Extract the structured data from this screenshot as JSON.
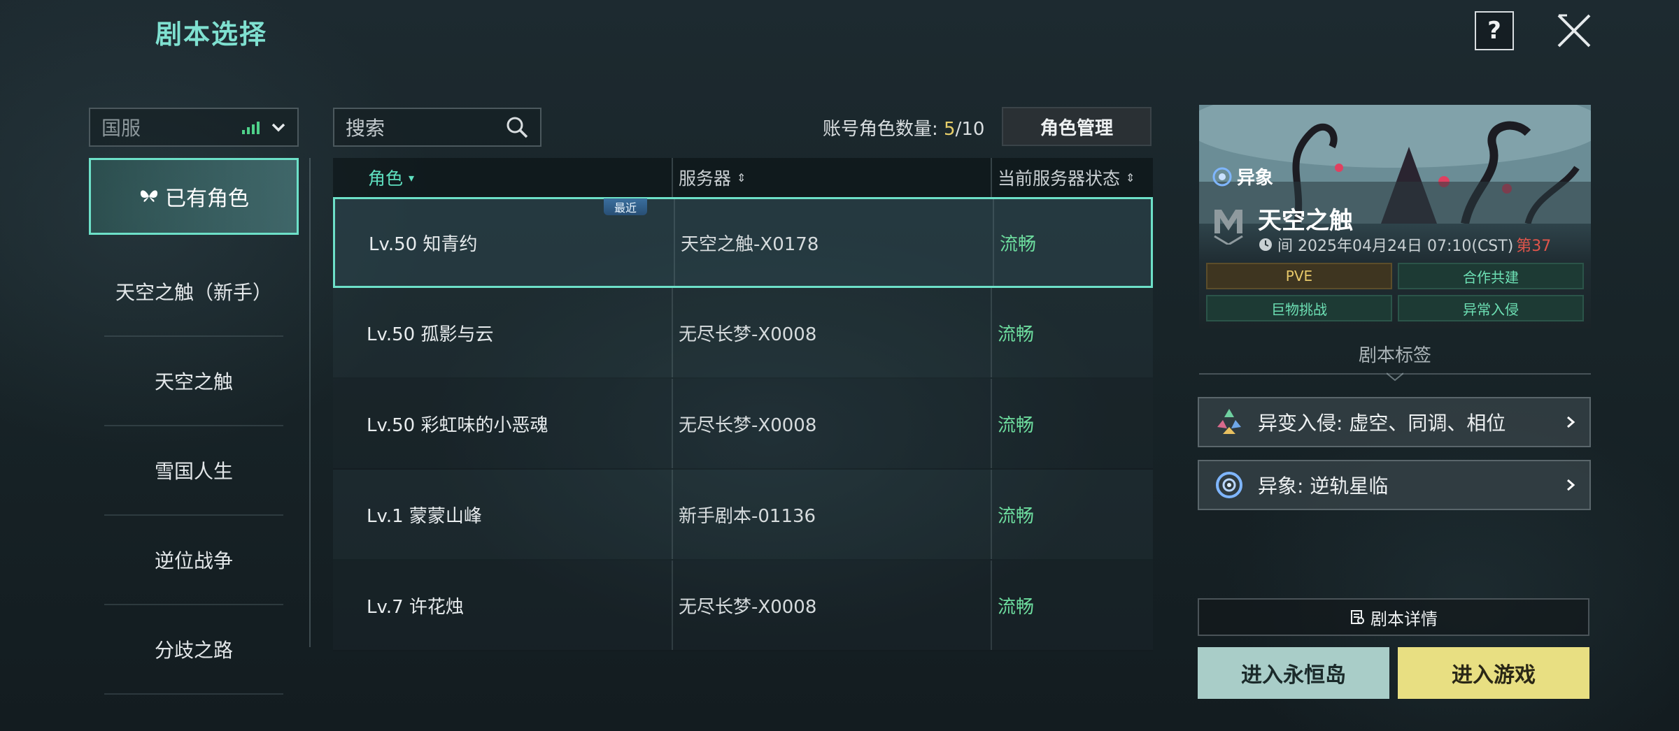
{
  "header": {
    "title": "剧本选择",
    "help_label": "?"
  },
  "colors": {
    "accent": "#6de0c8",
    "status_good": "#6ddc9e",
    "count_highlight": "#e7cf6a",
    "enter_game": "#e8df82",
    "enter_island": "#a9cdc8"
  },
  "region": {
    "label": "国服",
    "signal_icon": "signal-bars-icon"
  },
  "nav": {
    "items": [
      {
        "label": "已有角色",
        "icon": "butterfly-icon",
        "active": true
      },
      {
        "label": "天空之触（新手）"
      },
      {
        "label": "天空之触"
      },
      {
        "label": "雪国人生"
      },
      {
        "label": "逆位战争"
      },
      {
        "label": "分歧之路"
      }
    ]
  },
  "search": {
    "placeholder": "搜索"
  },
  "account": {
    "label": "账号角色数量:",
    "current": "5",
    "max": "/10",
    "manage_label": "角色管理"
  },
  "table": {
    "headers": [
      "角色",
      "服务器",
      "当前服务器状态"
    ],
    "recent_badge": "最近",
    "rows": [
      {
        "name": "Lv.50 知青约",
        "server": "天空之触-X0178",
        "status": "流畅"
      },
      {
        "name": "Lv.50 孤影与云",
        "server": "无尽长梦-X0008",
        "status": "流畅"
      },
      {
        "name": "Lv.50 彩虹味的小恶魂",
        "server": "无尽长梦-X0008",
        "status": "流畅"
      },
      {
        "name": "Lv.1 蒙蒙山峰",
        "server": "新手剧本-01136",
        "status": "流畅"
      },
      {
        "name": "Lv.7 许花烛",
        "server": "无尽长梦-X0008",
        "status": "流畅"
      }
    ]
  },
  "event": {
    "tag": "异象",
    "name": "天空之触",
    "time_prefix": "间 2025年04月24日 07:10(CST)",
    "season": "第37",
    "tags": [
      "PVE",
      "合作共建",
      "巨物挑战",
      "异常入侵"
    ]
  },
  "script_tags": {
    "title": "剧本标签",
    "features": [
      {
        "label": "异变入侵: 虚空、同调、相位",
        "icon": "mutation-icon"
      },
      {
        "label": "异象: 逆轨星临",
        "icon": "anomaly-ring-icon"
      }
    ]
  },
  "actions": {
    "details": "剧本详情",
    "enter_island": "进入永恒岛",
    "enter_game": "进入游戏"
  }
}
